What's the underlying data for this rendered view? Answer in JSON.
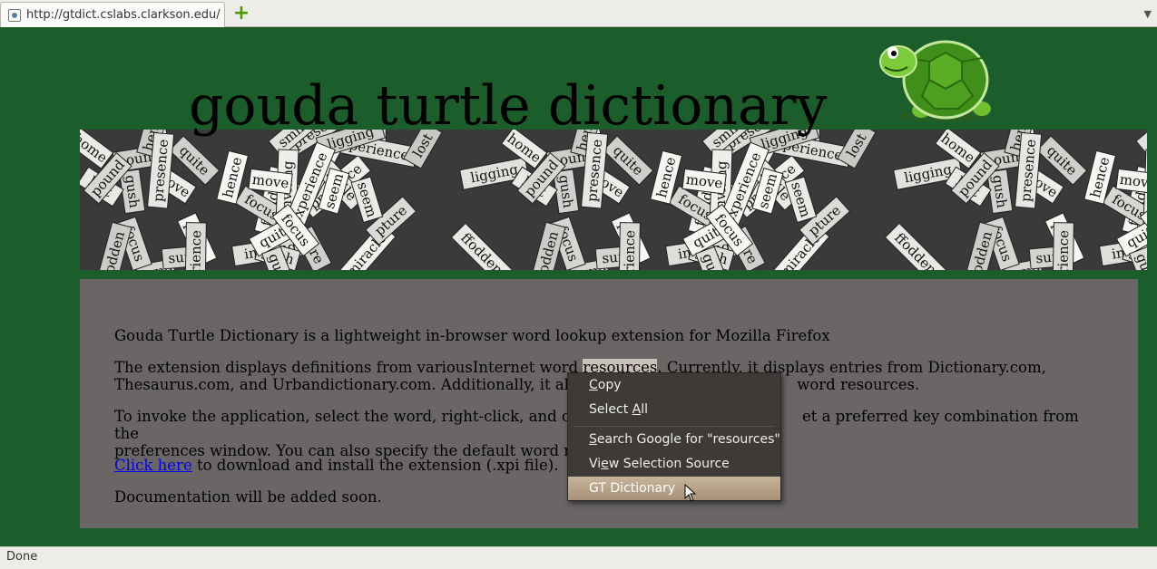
{
  "browser": {
    "tab_url": "http://gtdict.cslabs.clarkson.edu/",
    "new_tab_icon": "plus-icon",
    "tab_list_icon": "chevron-down-icon",
    "status": "Done"
  },
  "site": {
    "title": "gouda turtle dictionary",
    "logo_icon": "turtle-icon",
    "banner_words": [
      "pture",
      "ffodden",
      "presence",
      "move",
      "experience",
      "seem",
      "gush",
      "focus",
      "home",
      "miracle",
      "hence",
      "sure",
      "smile",
      "pound",
      "lost",
      "ligging",
      "inviting",
      "quite"
    ]
  },
  "content": {
    "p1": "Gouda Turtle Dictionary is a lightweight in-browser word lookup extension for Mozilla Firefox",
    "p2_before": "The extension displays definitions from variousInternet word ",
    "p2_selected": "resources",
    "p2_after": ". Currently, it displays entries from Dictionary.com,",
    "p2_line2_before": "Thesaurus.com, and Urbandictionary.com. Additionally, it allo",
    "p2_line2_after": "word resources.",
    "p3_line1_before": "To invoke the application, select the word, right-click, and clic",
    "p3_line1_after": "et a preferred key combination from the",
    "p3_line2_before": "preferences window. You can also specify the default word res",
    "p4_link": "Click here",
    "p4_rest": " to download and install the extension (.xpi file).",
    "p5": "Documentation will be added soon."
  },
  "context_menu": {
    "copy_pre": "",
    "copy_key": "C",
    "copy_post": "opy",
    "select_all_pre": "Select ",
    "select_all_key": "A",
    "select_all_post": "ll",
    "search_pre": "",
    "search_key": "S",
    "search_post": "earch Google for \"resources\"",
    "view_source_pre": "Vi",
    "view_source_key": "e",
    "view_source_post": "w Selection Source",
    "gt_dictionary": "GT Dictionary",
    "active_item": "GT Dictionary"
  },
  "colors": {
    "page_bg": "#1c5e2b",
    "content_bg": "#6a6666",
    "menu_bg": "#3d3a37",
    "menu_highlight": "#b29e82"
  }
}
